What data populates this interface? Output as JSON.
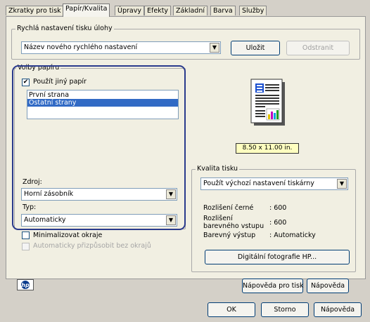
{
  "tabs": [
    {
      "label": "Zkratky pro tisk"
    },
    {
      "label": "Papír/Kvalita"
    },
    {
      "label": "Úpravy"
    },
    {
      "label": "Efekty"
    },
    {
      "label": "Základní"
    },
    {
      "label": "Barva"
    },
    {
      "label": "Služby"
    }
  ],
  "quick": {
    "legend": "Rychlá nastavení tisku úlohy",
    "combo_value": "Název nového rychlého nastavení",
    "save_label": "Uložit",
    "delete_label": "Odstranit"
  },
  "paper": {
    "legend": "Volby papíru",
    "use_other_paper_label": "Použít jiný papír",
    "list_items": [
      "První strana",
      "Ostatní strany"
    ],
    "source_label": "Zdroj:",
    "source_value": "Horní zásobník",
    "type_label": "Typ:",
    "type_value": "Automaticky"
  },
  "options": {
    "minimize_margins_label": "Minimalizovat okraje",
    "autofit_borderless_label": "Automaticky přizpůsobit bez okrajů"
  },
  "preview": {
    "size_label": "8.50 x 11.00 in."
  },
  "quality": {
    "legend": "Kvalita tisku",
    "combo_value": "Použít výchozí nastavení tiskárny",
    "rows": [
      {
        "label": "Rozlišení černé",
        "value": ": 600"
      },
      {
        "label": "Rozlišení\nbarevného vstupu",
        "value": ": 600"
      },
      {
        "label": "Barevný výstup",
        "value": ": Automaticky"
      }
    ],
    "hp_button": "Digitální fotografie HP..."
  },
  "bottom": {
    "print_help": "Nápověda pro tisk",
    "help": "Nápověda"
  },
  "footer": {
    "ok": "OK",
    "cancel": "Storno",
    "help": "Nápověda"
  },
  "highlight_color": "#2a3a8c",
  "selection_color": "#316ac5"
}
